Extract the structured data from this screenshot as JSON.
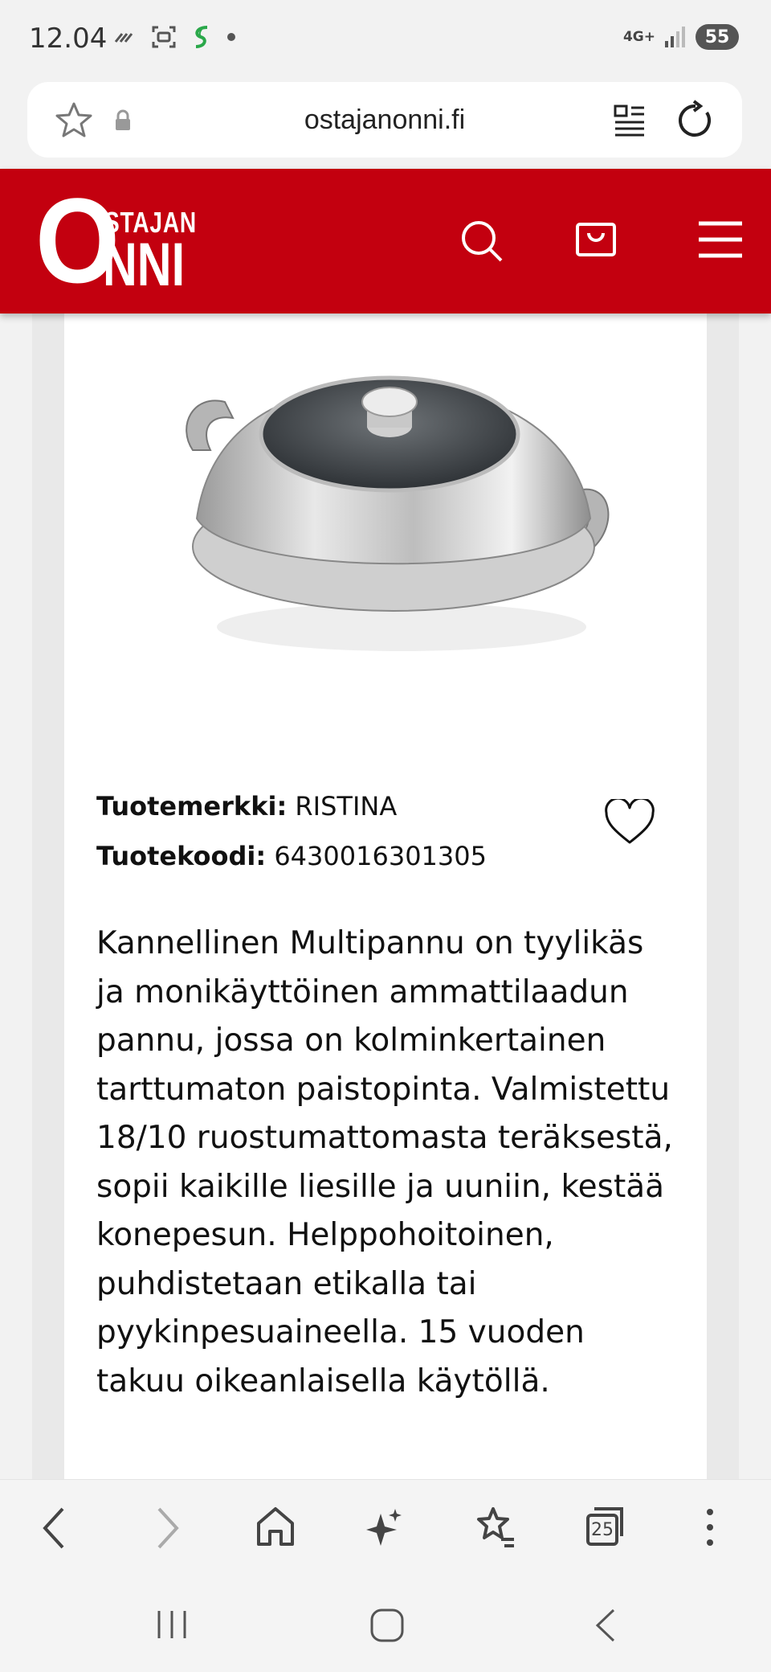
{
  "status_bar": {
    "time": "12.04",
    "network": "4G+",
    "battery": "55"
  },
  "url_bar": {
    "url": "ostajanonni.fi"
  },
  "site_header": {
    "logo_big_letter": "O",
    "logo_small": "STAJAN",
    "logo_rest": "NNI",
    "brand_color": "#c3000f"
  },
  "product": {
    "brand_label": "Tuotemerkki:",
    "brand_value": "RISTINA",
    "code_label": "Tuotekoodi:",
    "code_value": "6430016301305",
    "description": "Kannellinen Multipannu on tyylikäs ja monikäyttöinen ammattilaadun pannu, jossa on kolminkertainen tarttumaton paistopinta. Valmistettu 18/10 ruostumattomasta teräksestä, sopii kaikille liesille ja uuniin, kestää konepesun. Helppohoitoinen, puhdistetaan etikalla tai pyykinpesuaineella. 15 vuoden takuu oikeanlaisella käytöllä."
  },
  "toolbar": {
    "tab_count": "25"
  }
}
